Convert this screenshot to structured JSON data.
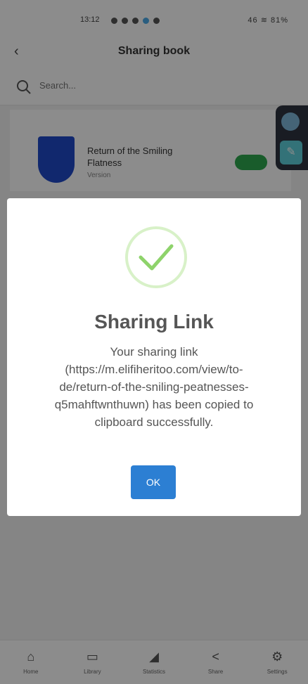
{
  "status_bar": {
    "time": "13:12",
    "right": "46 ≋ 81%"
  },
  "header": {
    "back_icon": "back-arrow-icon",
    "title": "Sharing book"
  },
  "search": {
    "placeholder": "Search..."
  },
  "book": {
    "title": "Return of the Smiling Flatness",
    "subtitle": "Version"
  },
  "modal": {
    "icon": "check-icon",
    "title": "Sharing Link",
    "message": "Your sharing link (https://m.elifiheritoo.com/view/to-de/return-of-the-sniling-peatnesses-q5mahftwnthuwn) has been copied to clipboard successfully.",
    "ok_label": "OK"
  },
  "bottom_nav": [
    {
      "icon": "home-icon",
      "label": "Home"
    },
    {
      "icon": "library-icon",
      "label": "Library"
    },
    {
      "icon": "chart-icon",
      "label": "Statistics"
    },
    {
      "icon": "share-icon",
      "label": "Share"
    },
    {
      "icon": "settings-icon",
      "label": "Settings"
    }
  ],
  "colors": {
    "accent": "#2c7fd3",
    "success": "#8ed36b",
    "badge": "#2fa84f"
  }
}
